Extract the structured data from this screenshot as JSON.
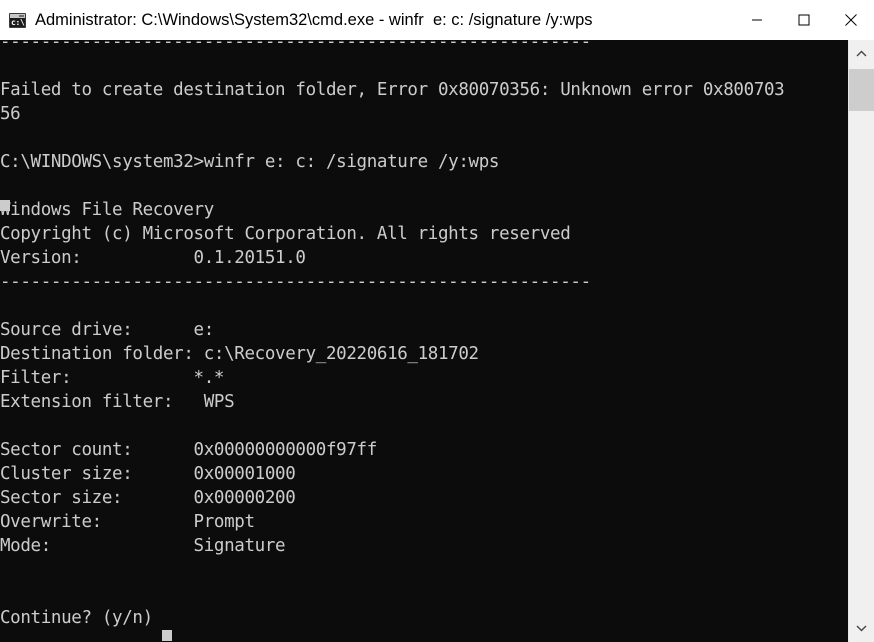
{
  "window": {
    "title": "Administrator: C:\\Windows\\System32\\cmd.exe - winfr  e: c: /signature /y:wps",
    "icon_label": "c:\\.",
    "background_color": "#0c0c0c",
    "text_color": "#cccccc",
    "titlebar_color": "#ffffff"
  },
  "titlebar": {
    "minimize_label": "—",
    "maximize_label": "□",
    "close_label": "✕"
  },
  "terminal": {
    "content": "----------------------------------------------------------\n\nFailed to create destination folder, Error 0x80070356: Unknown error 0x800703\n56\n\nC:\\WINDOWS\\system32>winfr e: c: /signature /y:wps\n\nWindows File Recovery\nCopyright (c) Microsoft Corporation. All rights reserved\nVersion:           0.1.20151.0\n----------------------------------------------------------\n\nSource drive:      e:\nDestination folder: c:\\Recovery_20220616_181702\nFilter:            *.*\nExtension filter:   WPS\n\nSector count:      0x00000000000f97ff\nCluster size:      0x00001000\nSector size:       0x00000200\nOverwrite:         Prompt\nMode:              Signature\n\n\nContinue? (y/n)",
    "lines": [
      "----------------------------------------------------------",
      "",
      "Failed to create destination folder, Error 0x80070356: Unknown error 0x800703",
      "56",
      "",
      "C:\\WINDOWS\\system32>winfr e: c: /signature /y:wps",
      "",
      "Windows File Recovery",
      "Copyright (c) Microsoft Corporation. All rights reserved",
      "Version:           0.1.20151.0",
      "----------------------------------------------------------",
      "",
      "Source drive:      e:",
      "Destination folder: c:\\Recovery_20220616_181702",
      "Filter:            *.*",
      "Extension filter:   WPS",
      "",
      "Sector count:      0x00000000000f97ff",
      "Cluster size:      0x00001000",
      "Sector size:       0x00000200",
      "Overwrite:         Prompt",
      "Mode:              Signature",
      "",
      "",
      "Continue? (y/n)"
    ],
    "error": {
      "message": "Failed to create destination folder, Error 0x80070356: Unknown error 0x80070356",
      "code": "0x80070356"
    },
    "command": "C:\\WINDOWS\\system32>winfr e: c: /signature /y:wps",
    "program": {
      "name": "Windows File Recovery",
      "copyright": "Copyright (c) Microsoft Corporation. All rights reserved",
      "version_label": "Version:",
      "version_value": "0.1.20151.0"
    },
    "parameters": [
      {
        "label": "Source drive:",
        "value": "e:"
      },
      {
        "label": "Destination folder:",
        "value": "c:\\Recovery_20220616_181702"
      },
      {
        "label": "Filter:",
        "value": "*.*"
      },
      {
        "label": "Extension filter:",
        "value": "WPS"
      },
      {
        "label": "Sector count:",
        "value": "0x00000000000f97ff"
      },
      {
        "label": "Cluster size:",
        "value": "0x00001000"
      },
      {
        "label": "Sector size:",
        "value": "0x00000200"
      },
      {
        "label": "Overwrite:",
        "value": "Prompt"
      },
      {
        "label": "Mode:",
        "value": "Signature"
      }
    ],
    "prompt": "Continue? (y/n)"
  },
  "scrollbar": {
    "up_arrow": "˄",
    "down_arrow": "˅"
  }
}
